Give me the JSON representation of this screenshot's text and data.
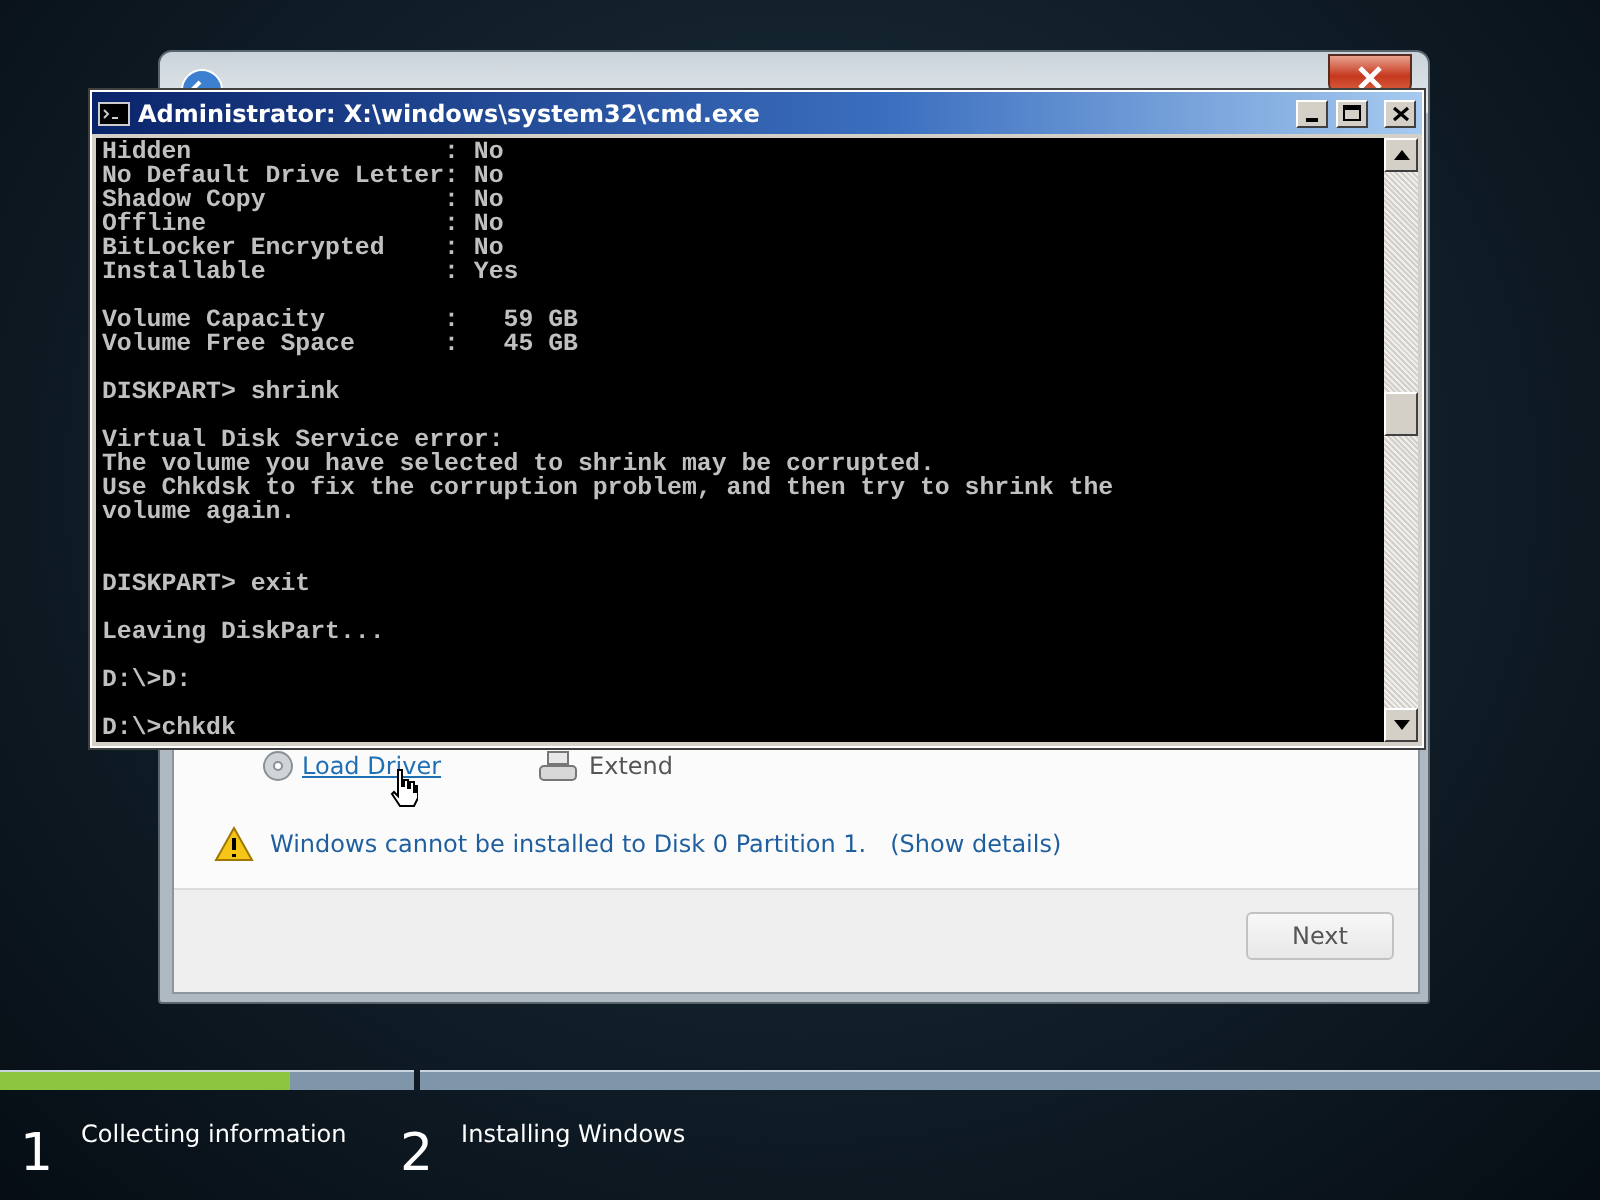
{
  "install_window": {
    "links": [
      {
        "label": "Load Driver",
        "enabled": true
      },
      {
        "label": "Extend",
        "enabled": false
      }
    ],
    "warning": {
      "message": "Windows cannot be installed to Disk 0 Partition 1.",
      "details_link": "(Show details)"
    },
    "next_button": {
      "label": "Next",
      "disabled": true
    }
  },
  "cmd_window": {
    "title": "Administrator: X:\\windows\\system32\\cmd.exe",
    "blocks": [
      {
        "kind": "text",
        "lines": [
          "Hidden                 : No",
          "No Default Drive Letter: No",
          "Shadow Copy            : No",
          "Offline                : No",
          "BitLocker Encrypted    : No",
          "Installable            : Yes"
        ]
      },
      {
        "kind": "text",
        "lines": [
          "Volume Capacity        :   59 GB",
          "Volume Free Space      :   45 GB"
        ]
      },
      {
        "kind": "text",
        "lines": [
          "DISKPART> shrink"
        ]
      },
      {
        "kind": "text",
        "lines": [
          "Virtual Disk Service error:",
          "The volume you have selected to shrink may be corrupted.",
          "Use Chkdsk to fix the corruption problem, and then try to shrink the",
          "volume again."
        ]
      },
      {
        "kind": "blank"
      },
      {
        "kind": "text",
        "lines": [
          "DISKPART> exit"
        ]
      },
      {
        "kind": "text",
        "lines": [
          "Leaving DiskPart..."
        ]
      },
      {
        "kind": "text",
        "lines": [
          "D:\\>D:"
        ]
      },
      {
        "kind": "text",
        "lines": [
          "D:\\>chkdk"
        ]
      }
    ]
  },
  "progress": {
    "steps": [
      {
        "number": "1",
        "label": "Collecting information",
        "level": 0.7
      },
      {
        "number": "2",
        "label": "Installing Windows",
        "level": 0
      }
    ]
  }
}
